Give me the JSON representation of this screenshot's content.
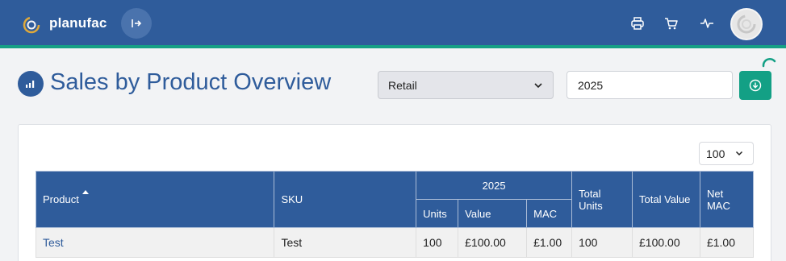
{
  "app": {
    "brand": "planufac"
  },
  "header": {
    "icons": [
      "print-icon",
      "cart-icon",
      "activity-icon"
    ]
  },
  "page": {
    "title": "Sales by Product Overview"
  },
  "filters": {
    "channel": "Retail",
    "year": "2025"
  },
  "table": {
    "page_size": "100",
    "columns": {
      "product": "Product",
      "sku": "SKU",
      "year_group": "2025",
      "units": "Units",
      "value": "Value",
      "mac": "MAC",
      "total_units": "Total Units",
      "total_value": "Total Value",
      "net_mac": "Net MAC"
    },
    "rows": [
      {
        "product": "Test",
        "sku": "Test",
        "units": "100",
        "value": "£100.00",
        "mac": "£1.00",
        "total_units": "100",
        "total_value": "£100.00",
        "net_mac": "£1.00"
      }
    ]
  },
  "colors": {
    "primary": "#2f5c9b",
    "accent": "#13a085"
  }
}
